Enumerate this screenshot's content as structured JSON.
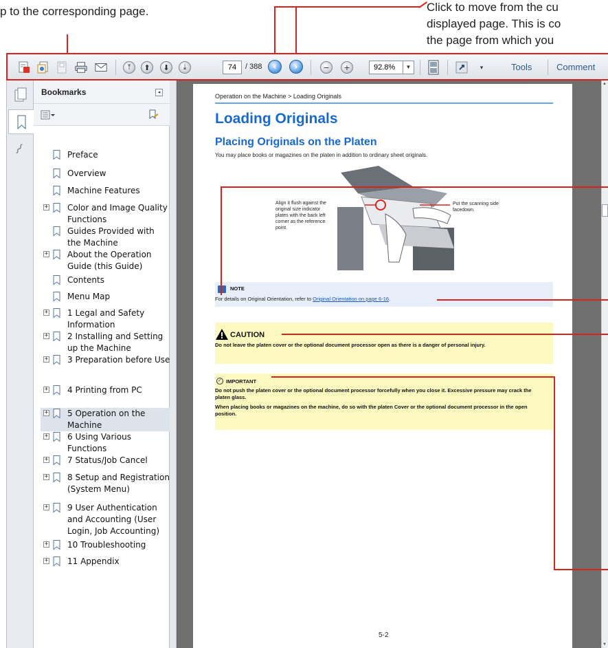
{
  "callouts": {
    "left_text": "p to the corresponding page.",
    "right_line1": "Click to move from the cu",
    "right_line2": "displayed page. This is co",
    "right_line3": "the page from which you"
  },
  "toolbar": {
    "page_current": "74",
    "page_total": "/ 388",
    "zoom": "92.8%",
    "tools_label": "Tools",
    "comment_label": "Comment"
  },
  "bookmarks": {
    "title": "Bookmarks",
    "items": [
      {
        "label": "Preface",
        "expandable": false
      },
      {
        "label": "Overview",
        "expandable": false
      },
      {
        "label": "Machine Features",
        "expandable": false
      },
      {
        "label": "Color and Image Quality Functions",
        "expandable": true
      },
      {
        "label": "Guides Provided with the Machine",
        "expandable": false
      },
      {
        "label": "About the Operation Guide (this Guide)",
        "expandable": true
      },
      {
        "label": "Contents",
        "expandable": false
      },
      {
        "label": "Menu Map",
        "expandable": false
      },
      {
        "label": "1 Legal and Safety Information",
        "expandable": true
      },
      {
        "label": "2 Installing and Setting up the Machine",
        "expandable": true
      },
      {
        "label": "3 Preparation before Use",
        "expandable": true
      },
      {
        "label": "4 Printing from PC",
        "expandable": true
      },
      {
        "label": "5 Operation on the Machine",
        "expandable": true,
        "selected": true
      },
      {
        "label": "6 Using Various Functions",
        "expandable": true
      },
      {
        "label": "7 Status/Job Cancel",
        "expandable": true
      },
      {
        "label": "8 Setup and Registration (System Menu)",
        "expandable": true
      },
      {
        "label": "9 User Authentication and Accounting (User Login, Job Accounting)",
        "expandable": true
      },
      {
        "label": "10 Troubleshooting",
        "expandable": true
      },
      {
        "label": "11 Appendix",
        "expandable": true
      }
    ]
  },
  "document": {
    "breadcrumb": "Operation on the Machine > Loading Originals",
    "title": "Loading Originals",
    "subtitle": "Placing Originals on the Platen",
    "intro": "You may place books or magazines on the platen in addition to ordinary sheet originals.",
    "figure_left_label": "Align it flush against the original size indicator plates with the back left corner as the reference point.",
    "figure_right_label": "Put the scanning side facedown.",
    "note_heading": "NOTE",
    "note_text": "For details on Original Orientation, refer to ",
    "note_link": "Original Orientation on page 6-16",
    "caution_heading": "CAUTION",
    "caution_text": "Do not leave the platen cover or the optional document processor open as there is a danger of personal injury.",
    "important_heading": "IMPORTANT",
    "important_text1": "Do not push the platen cover or the optional document processor forcefully when you close it. Excessive pressure may crack the platen glass.",
    "important_text2": "When placing books or magazines on the machine, do so with the platen Cover or the optional document processor in the open position.",
    "page_number": "5-2"
  },
  "colors": {
    "annotation_red": "#d9221c",
    "heading_blue": "#1868d2",
    "caution_yellow": "#fcf9c0",
    "note_blue": "#e8eef7"
  }
}
